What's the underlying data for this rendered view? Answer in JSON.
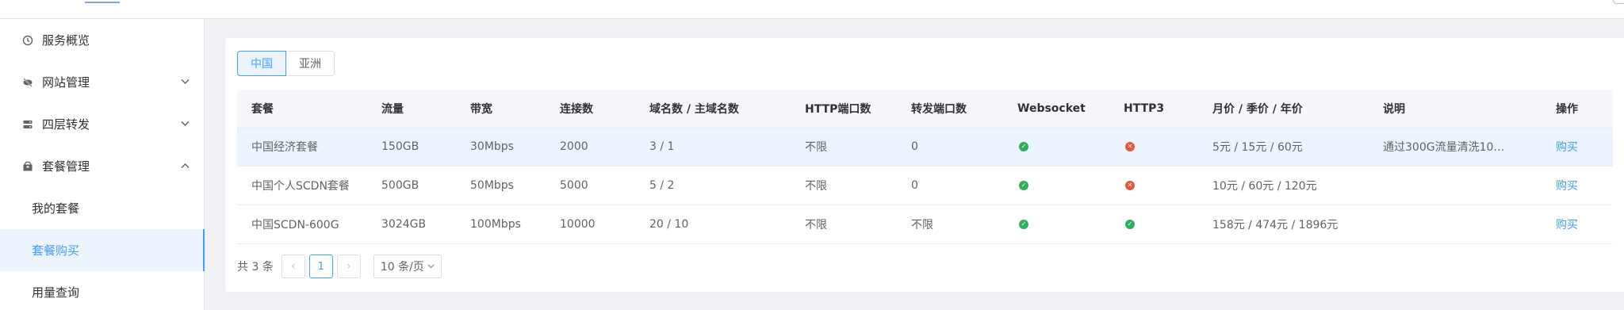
{
  "sidebar": {
    "items": [
      {
        "label": "服务概览",
        "icon": "clock-icon"
      },
      {
        "label": "网站管理",
        "icon": "eye-off-icon"
      },
      {
        "label": "四层转发",
        "icon": "server-icon"
      },
      {
        "label": "套餐管理",
        "icon": "package-icon"
      }
    ],
    "sub_items": [
      {
        "label": "我的套餐"
      },
      {
        "label": "套餐购买"
      },
      {
        "label": "用量查询"
      }
    ]
  },
  "tabs": [
    {
      "label": "中国"
    },
    {
      "label": "亚洲"
    }
  ],
  "table": {
    "headers": [
      "套餐",
      "流量",
      "带宽",
      "连接数",
      "域名数 / 主域名数",
      "HTTP端口数",
      "转发端口数",
      "Websocket",
      "HTTP3",
      "月价 / 季价 / 年价",
      "说明",
      "操作"
    ],
    "rows": [
      {
        "name": "中国经济套餐",
        "traffic": "150GB",
        "bandwidth": "30Mbps",
        "connections": "2000",
        "domains": "3 / 1",
        "http_ports": "不限",
        "forward_ports": "0",
        "websocket": "check",
        "http3": "cross",
        "price": "5元 / 15元 / 60元",
        "desc": "通过300G流量清洗10…",
        "action": "购买"
      },
      {
        "name": "中国个人SCDN套餐",
        "traffic": "500GB",
        "bandwidth": "50Mbps",
        "connections": "5000",
        "domains": "5 / 2",
        "http_ports": "不限",
        "forward_ports": "0",
        "websocket": "check",
        "http3": "cross",
        "price": "10元 / 60元 / 120元",
        "desc": "",
        "action": "购买"
      },
      {
        "name": "中国SCDN-600G",
        "traffic": "3024GB",
        "bandwidth": "100Mbps",
        "connections": "10000",
        "domains": "20 / 10",
        "http_ports": "不限",
        "forward_ports": "不限",
        "websocket": "check",
        "http3": "check",
        "price": "158元 / 474元 / 1896元",
        "desc": "",
        "action": "购买"
      }
    ]
  },
  "pagination": {
    "total": "共 3 条",
    "prev": "‹",
    "page": "1",
    "next": "›",
    "page_size": "10 条/页"
  },
  "colors": {
    "accent": "#409eff",
    "success": "#2fae5c",
    "danger": "#e4573e"
  }
}
